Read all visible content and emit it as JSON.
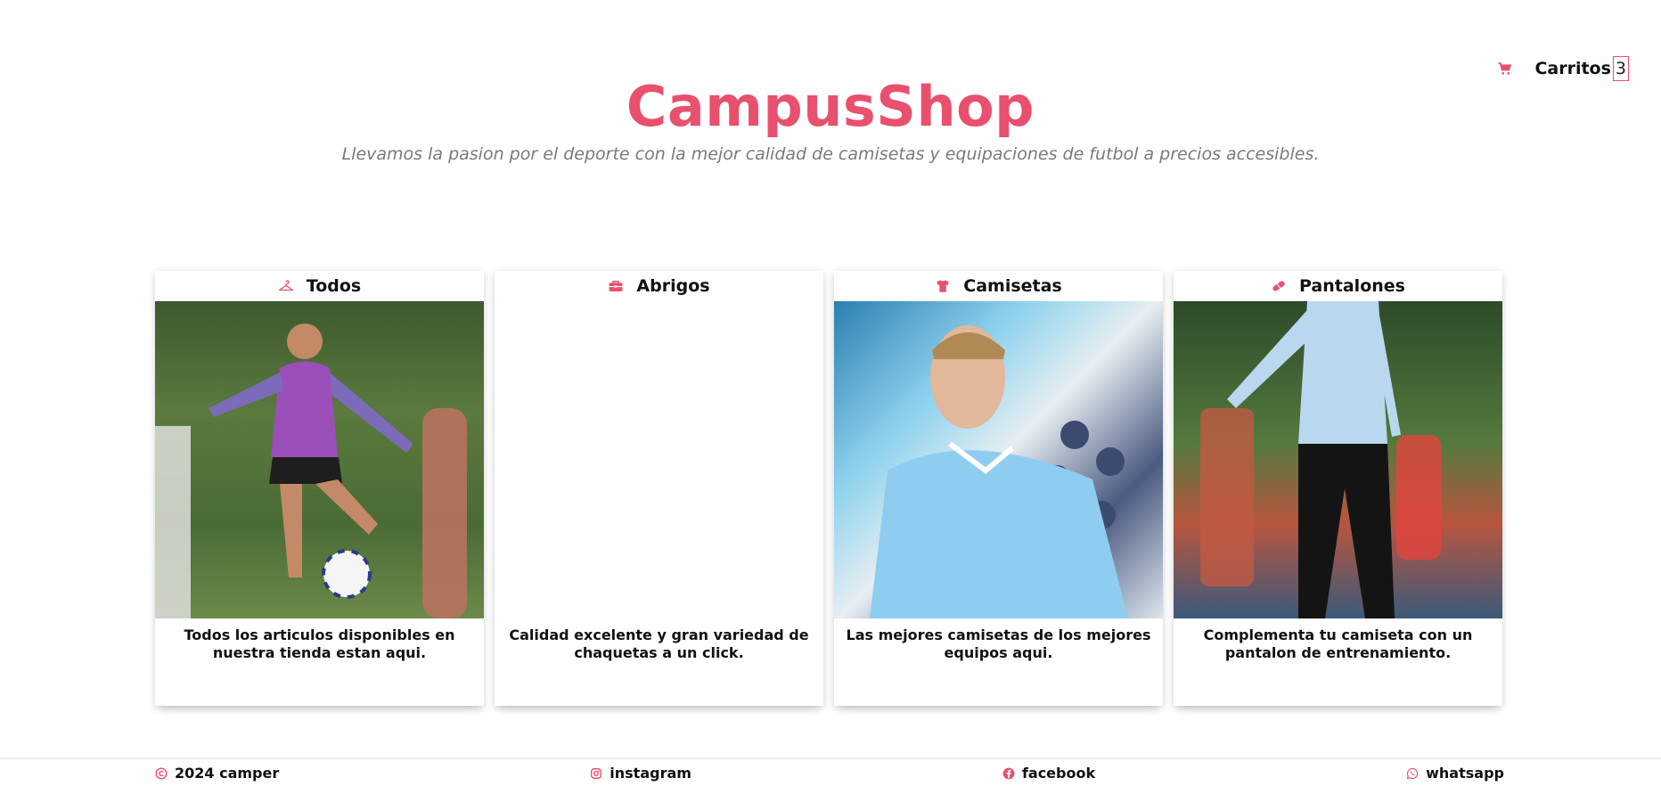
{
  "brand": {
    "title": "CampusShop",
    "tagline": "Llevamos la pasion por el deporte con la mejor calidad de camisetas y equipaciones de futbol a precios accesibles."
  },
  "cart": {
    "icon": "cart-icon",
    "label": "Carritos",
    "count": "3"
  },
  "colors": {
    "accent": "#e8506e"
  },
  "cards": [
    {
      "icon": "hanger-icon",
      "title": "Todos",
      "description": "Todos los articulos disponibles en nuestra tienda estan aqui."
    },
    {
      "icon": "briefcase-icon",
      "title": "Abrigos",
      "description": "Calidad excelente y gran variedad de chaquetas a un click."
    },
    {
      "icon": "shirt-icon",
      "title": "Camisetas",
      "description": "Las mejores camisetas de los mejores equipos aqui."
    },
    {
      "icon": "pill-icon",
      "title": "Pantalones",
      "description": "Complementa tu camiseta con un pantalon de entrenamiento."
    }
  ],
  "footer": {
    "copyright": "2024 camper",
    "instagram": "instagram",
    "facebook": "facebook",
    "whatsapp": "whatsapp"
  }
}
